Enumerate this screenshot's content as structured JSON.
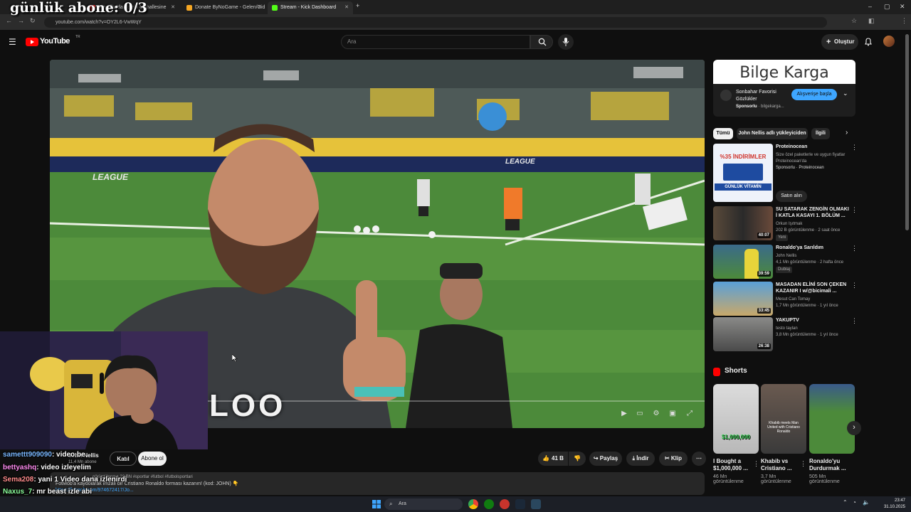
{
  "overlay": {
    "title": "günlük abone: 0/3"
  },
  "browser": {
    "tabs": [
      {
        "label": "Amerika'da Zombi Mahallesine",
        "color": "#ff3333"
      },
      {
        "label": "Donate ByNoGame - Gelen/Gid",
        "color": "#f5a623"
      },
      {
        "label": "Stream - Kick Dashboard",
        "color": "#53fc18"
      }
    ],
    "url": "youtube.com/watch?v=OY2L6-VwWqY"
  },
  "youtube": {
    "logo_text": "YouTube",
    "logo_region": "TR",
    "search_placeholder": "Ara",
    "create_label": "Oluştur"
  },
  "video": {
    "board_text_1": "LEAGUE",
    "board_text_2": "LEAGUE",
    "caption_text": "LOO"
  },
  "channel": {
    "name": "John Nellis",
    "subs": "11,4 Mn abone",
    "join_label": "Katıl",
    "subscribe_label": "Abone ol"
  },
  "actions": {
    "likes": "41 B",
    "share": "Paylaş",
    "download": "İndir",
    "clip": "Klip"
  },
  "description": {
    "line1": "görüntülenme  20 BN  #sportlar #futbol #futbolsportlari",
    "line2": "FotMob'a kaydolarak imzalı bir Cristiano Ronaldo forması kazanın! (kod: JOHN) 👇",
    "line3": "https://fotmob.com/974672417/Jo..."
  },
  "chat": [
    {
      "user": "samettt909090",
      "msg": ": video be",
      "color": "#7ab8ff"
    },
    {
      "user": "bettyashq",
      "msg": ": video izleyelim",
      "color": "#ff8cf0"
    },
    {
      "user": "Sema208",
      "msg": ": yani 1 Video dana izlenirdi",
      "color": "#ff8c8c"
    },
    {
      "user": "Naxus_7",
      "msg": ": mr beast izle abi",
      "color": "#8cff9c"
    }
  ],
  "ad": {
    "banner": "Bilge Karga",
    "title": "Sonbahar Favorisi Gözlükler",
    "sponsor": "Sponsorlu",
    "domain": "bilgekarga...",
    "cta": "Alışverişe başla"
  },
  "chips": [
    "Tümü",
    "John Nellis adlı yükleyiciden",
    "İlgili"
  ],
  "recommendations": [
    {
      "title": "Proteinocean",
      "line1": "Size özel paketlerle ve uygun fiyatlar",
      "line2": "Proteinocean'da",
      "line3": "Sponsorlu · Proteinocean",
      "thumb_top": "%35 İNDİRİMLER",
      "thumb_bottom": "GÜNLÜK VİTAMİN",
      "cta": "Satın alın"
    },
    {
      "title": "SU SATARAK ZENGİN OLMAKI İ KATLA KASAYI 1. BÖLÜM ...",
      "channel": "Orkun Işıtmak",
      "stats": "202 B görüntülenme · 2 saat önce",
      "badge": "Yeni",
      "duration": "40:07"
    },
    {
      "title": "Ronaldo'ya Sarıldım",
      "channel": "John Nellis",
      "stats": "4,1 Mn görüntülenme · 2 hafta önce",
      "badge": "Dublaj",
      "duration": "39:59"
    },
    {
      "title": "MASADAN ELİNİ SON ÇEKEN KAZANIR I w/@bicimali ...",
      "channel": "Mesut Can Tomay",
      "stats": "1,7 Mn görüntülenme · 1 yıl önce",
      "duration": "33:45"
    },
    {
      "title": "YAKUPTV",
      "channel": "testo taylan",
      "stats": "3,8 Mn görüntülenme · 1 yıl önce",
      "duration": "26:38"
    }
  ],
  "shorts": {
    "header": "Shorts",
    "items": [
      {
        "title": "I Bought a $1,000,000 ...",
        "views": "46 Mn görüntülenme",
        "thumb_text": "$1,000,000"
      },
      {
        "title": "Khabib vs Cristiano ...",
        "views": "3,7 Mn görüntülenme",
        "thumb_text": "Khabib meets Man United with Cristiano Ronaldo"
      },
      {
        "title": "Ronaldo'yu Durdurmak ...",
        "views": "505 Mn görüntülenme",
        "thumb_text": ""
      }
    ]
  },
  "taskbar": {
    "search": "Ara",
    "time": "23:47",
    "date": "31.10.2025"
  }
}
